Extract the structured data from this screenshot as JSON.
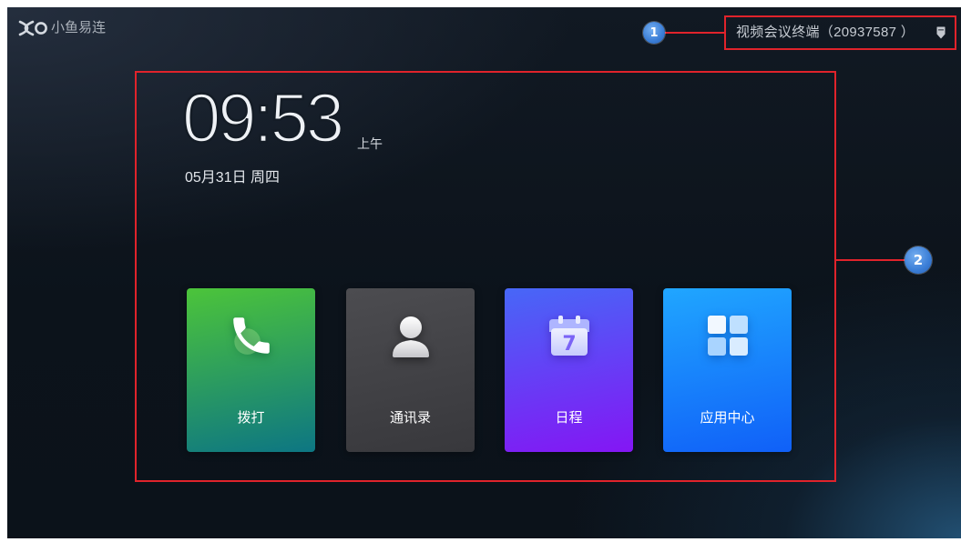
{
  "app": {
    "logo_text": "小鱼易连",
    "logo_icon": "xiaoyu-logo-icon",
    "device": {
      "name": "视频会议终端（20937587 ）",
      "icon": "badge-icon"
    }
  },
  "clock": {
    "time": "09:53",
    "period": "上午",
    "date": "05月31日 周四"
  },
  "tiles": [
    {
      "label": "拨打",
      "icon": "phone-icon",
      "color_top": "#4cc43a",
      "color_bottom": "#0d7683"
    },
    {
      "label": "通讯录",
      "icon": "contact-icon",
      "color_top": "#4c4c50",
      "color_bottom": "#38383c"
    },
    {
      "label": "日程",
      "icon": "calendar-icon",
      "icon_text": "7",
      "color_top": "#4767f7",
      "color_bottom": "#8416f4"
    },
    {
      "label": "应用中心",
      "icon": "app-grid-icon",
      "color_top": "#20a6ff",
      "color_bottom": "#1060f8"
    }
  ],
  "annotations": [
    {
      "label": "1"
    },
    {
      "label": "2"
    }
  ],
  "colors": {
    "annotation_red": "#e0232b",
    "marker_blue": "#3a7dd6"
  }
}
